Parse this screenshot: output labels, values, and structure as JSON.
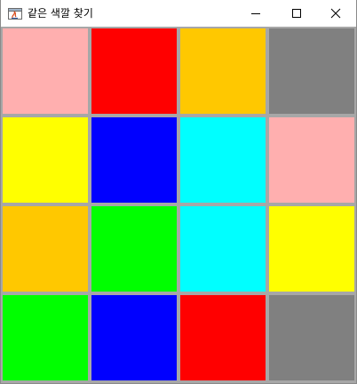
{
  "window": {
    "title": "같은 색깔 찾기",
    "controls": {
      "minimize_icon": "minimize-icon",
      "maximize_icon": "maximize-icon",
      "close_icon": "close-icon"
    }
  },
  "grid": {
    "rows": 4,
    "cols": 4,
    "cells": [
      [
        "#ffafaf",
        "#ff0000",
        "#ffc800",
        "#808080"
      ],
      [
        "#ffff00",
        "#0000ff",
        "#00ffff",
        "#ffafaf"
      ],
      [
        "#ffc800",
        "#00ff00",
        "#00ffff",
        "#ffff00"
      ],
      [
        "#00ff00",
        "#0000ff",
        "#ff0000",
        "#808080"
      ]
    ]
  }
}
